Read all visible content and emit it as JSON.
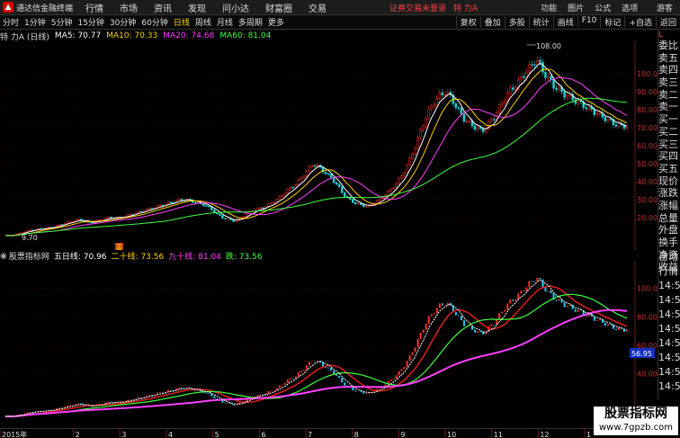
{
  "menubar": {
    "app_name": "通达信金融终端",
    "menus": [
      "行情",
      "市场",
      "资讯",
      "发现",
      "问小达",
      "财富圈",
      "交易"
    ],
    "notice": "证券交易未登录",
    "stock": "特 力A",
    "right_menus": [
      "功能",
      "图片",
      "公式",
      "选项"
    ],
    "guest": "游客"
  },
  "toolbar": {
    "periods": [
      "分时",
      "1分钟",
      "5分钟",
      "15分钟",
      "30分钟",
      "60分钟",
      "日线",
      "周线",
      "月线",
      "多周期",
      "更多"
    ],
    "active_period": "日线",
    "right_buttons": [
      "复权",
      "叠加",
      "多股",
      "统计",
      "画线",
      "F10",
      "标记",
      "+自选",
      "返回"
    ]
  },
  "main_chart": {
    "title": "特 力A (日线)",
    "ma_labels": [
      {
        "text": "MA5: 70.77",
        "color": "#ffffff"
      },
      {
        "text": "MA10: 70.33",
        "color": "#ffd000"
      },
      {
        "text": "MA20: 74.68",
        "color": "#ff40ff"
      },
      {
        "text": "MA60: 81.04",
        "color": "#40ff40"
      }
    ],
    "high_label": "108.00",
    "low_label": "9.70",
    "marker_label": "富",
    "y_ticks": [
      "100.0",
      "90.00",
      "80.00",
      "70.00",
      "60.00",
      "50.00",
      "40.00",
      "30.00",
      "20.00"
    ]
  },
  "sub_chart": {
    "title": "股票指标网",
    "labels": [
      {
        "text": "五日线: 70.96",
        "color": "#ffffff"
      },
      {
        "text": "二十线: 73.56",
        "color": "#ffd000"
      },
      {
        "text": "九十线: 81.04",
        "color": "#ff40ff"
      },
      {
        "text": "跌: 73.56",
        "color": "#40ff40"
      }
    ],
    "y_ticks": [
      "100.0",
      "80.00",
      "60.00",
      "40.00"
    ],
    "current_value": "56.95"
  },
  "x_axis": {
    "labels": [
      "2015年",
      "2",
      "3",
      "4",
      "5",
      "6",
      "7",
      "8",
      "9",
      "10",
      "11",
      "12",
      "1"
    ]
  },
  "right_panel": {
    "items": [
      "委比",
      "卖五",
      "卖四",
      "卖三",
      "卖二",
      "卖一",
      "买一",
      "买二",
      "买三",
      "买四",
      "买五",
      "现价",
      "涨跌",
      "涨幅",
      "总量",
      "外盘",
      "换手",
      "净资",
      "收益"
    ],
    "top_label": "L"
  },
  "right_panel2": {
    "items": [
      "自动",
      "行情",
      "14:50",
      "14:50",
      "14:50",
      "14:50",
      "14:50",
      "14:50",
      "14:50",
      "14:50"
    ]
  },
  "watermark": {
    "line1": "股票指标网",
    "line2": "www.7gpzb.com"
  },
  "chart_data": {
    "type": "candlestick",
    "close": [
      10,
      10,
      11,
      12,
      13,
      13.5,
      14,
      14.2,
      15,
      16,
      17,
      18,
      19,
      18,
      17,
      18,
      19,
      20,
      20,
      20,
      21,
      22,
      23,
      24,
      25,
      26,
      27,
      28,
      29,
      30,
      30,
      29,
      28,
      27,
      25,
      22,
      20,
      19,
      18,
      20,
      22,
      24,
      25,
      26,
      28,
      30,
      33,
      36,
      38,
      42,
      46,
      50,
      48,
      45,
      42,
      38,
      33,
      30,
      28,
      27,
      26,
      28,
      30,
      33,
      36,
      40,
      45,
      52,
      60,
      70,
      78,
      84,
      88,
      90,
      86,
      80,
      75,
      72,
      70,
      68,
      72,
      76,
      82,
      88,
      92,
      95,
      100,
      104,
      108,
      102,
      97,
      93,
      90,
      88,
      86,
      84,
      82,
      80,
      78,
      76,
      74,
      72,
      71,
      70.77
    ]
  }
}
